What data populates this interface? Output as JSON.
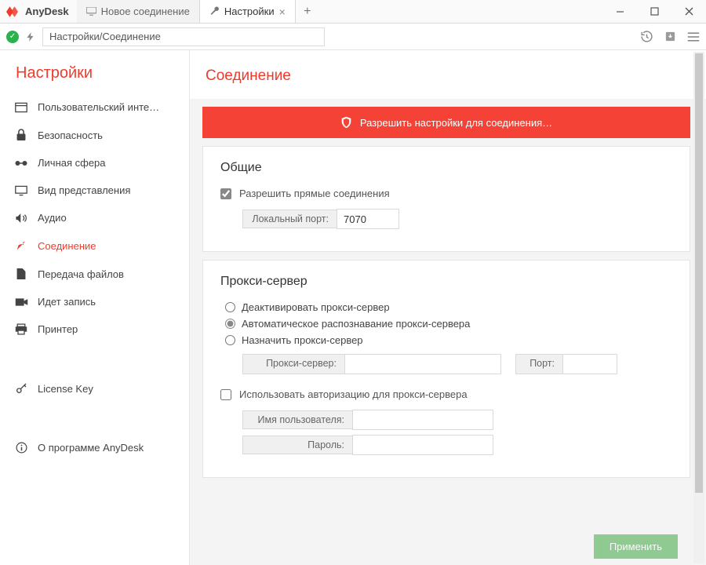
{
  "brand": "AnyDesk",
  "tabs": [
    {
      "label": "Новое соединение",
      "active": false,
      "closable": false
    },
    {
      "label": "Настройки",
      "active": true,
      "closable": true
    }
  ],
  "address_bar": "Настройки/Соединение",
  "sidebar": {
    "title": "Настройки",
    "items": [
      {
        "icon": "ui",
        "label": "Пользовательский инте…"
      },
      {
        "icon": "lock",
        "label": "Безопасность"
      },
      {
        "icon": "glasses",
        "label": "Личная сфера"
      },
      {
        "icon": "display",
        "label": "Вид представления"
      },
      {
        "icon": "audio",
        "label": "Аудио"
      },
      {
        "icon": "connection",
        "label": "Соединение"
      },
      {
        "icon": "transfer",
        "label": "Передача файлов"
      },
      {
        "icon": "record",
        "label": "Идет запись"
      },
      {
        "icon": "printer",
        "label": "Принтер"
      },
      {
        "icon": "key",
        "label": "License Key"
      },
      {
        "icon": "info",
        "label": "О программе AnyDesk"
      }
    ],
    "active_index": 5
  },
  "page": {
    "title": "Соединение",
    "alert": "Разрешить настройки для соединения…",
    "general": {
      "heading": "Общие",
      "allow_direct_label": "Разрешить прямые соединения",
      "allow_direct_checked": true,
      "local_port_label": "Локальный порт:",
      "local_port_value": "7070"
    },
    "proxy": {
      "heading": "Прокси-сервер",
      "options": [
        "Деактивировать прокси-сервер",
        "Автоматическое распознавание прокси-сервера",
        "Назначить прокси-сервер"
      ],
      "selected_option": 1,
      "server_label": "Прокси-сервер:",
      "server_value": "",
      "port_label": "Порт:",
      "port_value": "",
      "use_auth_label": "Использовать авторизацию для прокси-сервера",
      "use_auth_checked": false,
      "user_label": "Имя пользователя:",
      "user_value": "",
      "pass_label": "Пароль:",
      "pass_value": ""
    },
    "apply_label": "Применить"
  }
}
